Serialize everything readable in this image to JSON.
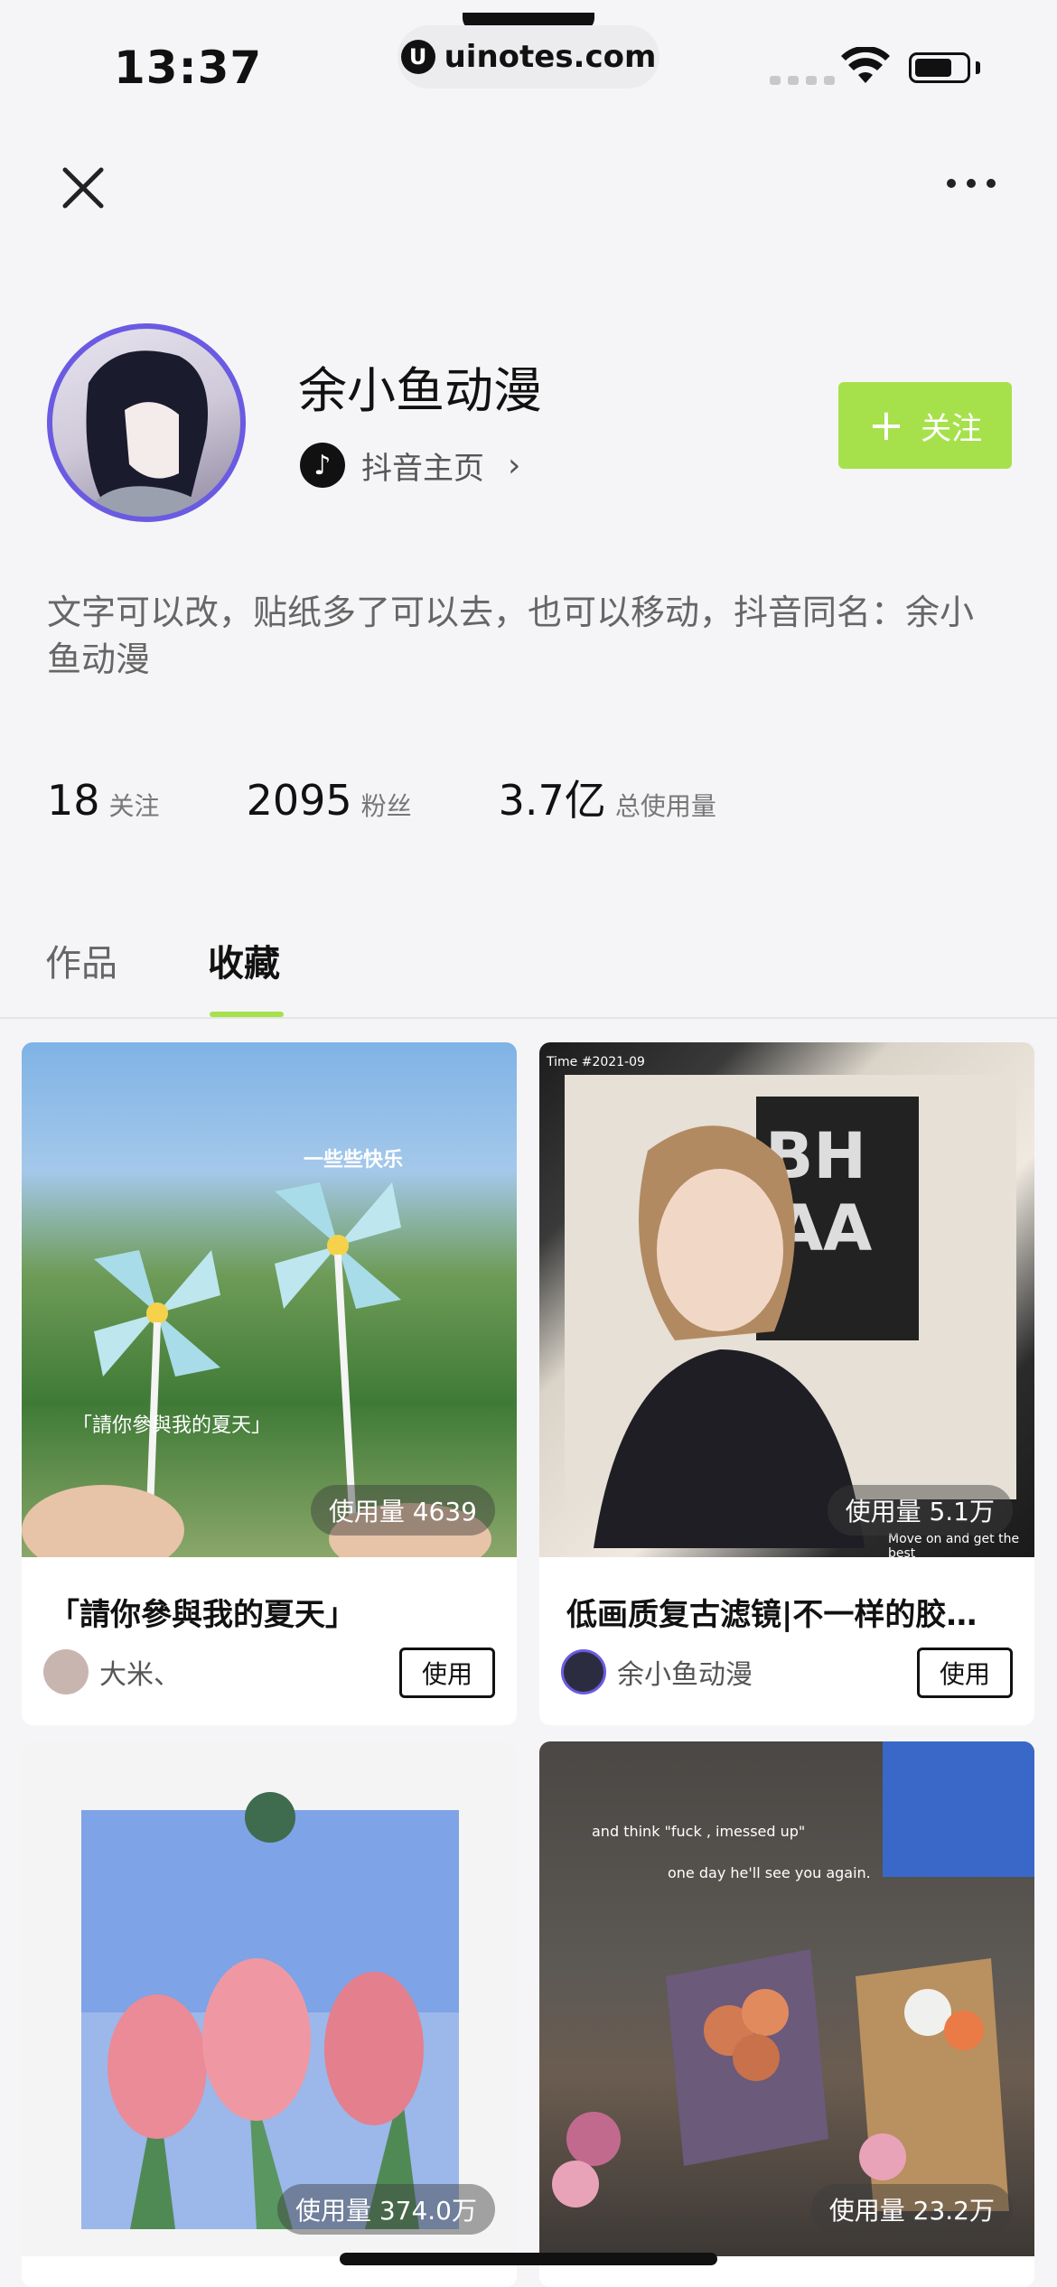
{
  "status": {
    "time": "13:37",
    "url": "uinotes.com",
    "url_logo": "U"
  },
  "header": {
    "close_icon": "close-icon",
    "more_icon": "more-icon"
  },
  "profile": {
    "name": "余小鱼动漫",
    "tiktok_label": "抖音主页",
    "tiktok_icon": "♪",
    "follow_label": "关注",
    "bio": "文字可以改，贴纸多了可以去，也可以移动，抖音同名：余小鱼动漫"
  },
  "stats": [
    {
      "num": "18",
      "label": "关注"
    },
    {
      "num": "2095",
      "label": "粉丝"
    },
    {
      "num": "3.7亿",
      "label": "总使用量"
    }
  ],
  "tabs": [
    {
      "label": "作品",
      "active": false
    },
    {
      "label": "收藏",
      "active": true
    }
  ],
  "cards": [
    {
      "usage": "使用量 4639",
      "title": "「請你參與我的夏天」",
      "author": "大米、",
      "use_label": "使用",
      "overlay_top": "一些些快乐",
      "overlay_mid": "「請你參與我的夏天」"
    },
    {
      "usage": "使用量 5.1万",
      "title": "低画质复古滤镜|不一样的胶…",
      "author": "余小鱼动漫",
      "use_label": "使用",
      "overlay_top": "Time #2021-09",
      "overlay_bottom": "Move on and get the best"
    },
    {
      "usage": "使用量 374.0万"
    },
    {
      "usage": "使用量 23.2万",
      "overlay_top": "and think \"fuck , imessed up\"",
      "overlay_mid": "one day he'll see you again."
    }
  ],
  "colors": {
    "accent": "#a6e14c",
    "avatar_ring": "#6a5be2"
  }
}
